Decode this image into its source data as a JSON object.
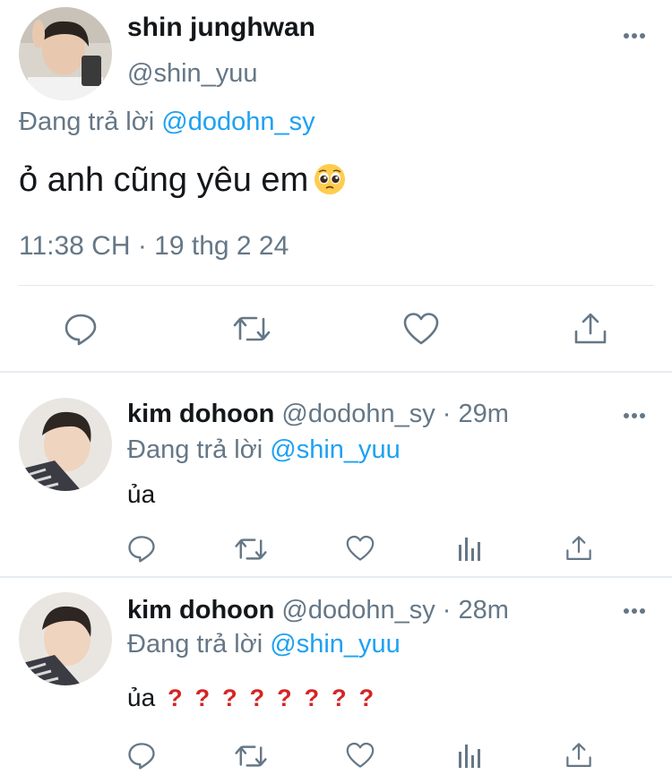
{
  "main_tweet": {
    "author_name": "shin junghwan",
    "author_handle": "@shin_yuu",
    "reply_prefix": "Đang trả lời",
    "reply_to": "@dodohn_sy",
    "text": "ỏ anh cũng yêu em",
    "emoji": "pleading-face-emoji",
    "timestamp": "11:38 CH · 19 thg 2 24",
    "actions": [
      "reply-icon",
      "retweet-icon",
      "like-icon",
      "share-icon"
    ]
  },
  "replies": [
    {
      "author_name": "kim dohoon",
      "author_handle": "@dodohn_sy",
      "separator": "·",
      "time": "29m",
      "reply_prefix": "Đang trả lời",
      "reply_to": "@shin_yuu",
      "text": "ủa",
      "question_marks": []
    },
    {
      "author_name": "kim dohoon",
      "author_handle": "@dodohn_sy",
      "separator": "·",
      "time": "28m",
      "reply_prefix": "Đang trả lời",
      "reply_to": "@shin_yuu",
      "text": "ủa",
      "question_marks": [
        "?",
        "?",
        "?",
        "?",
        "?",
        "?",
        "?",
        "?"
      ]
    }
  ],
  "colors": {
    "accent_blue": "#1da1f2",
    "secondary_gray": "#657786",
    "question_red": "#d62424"
  }
}
